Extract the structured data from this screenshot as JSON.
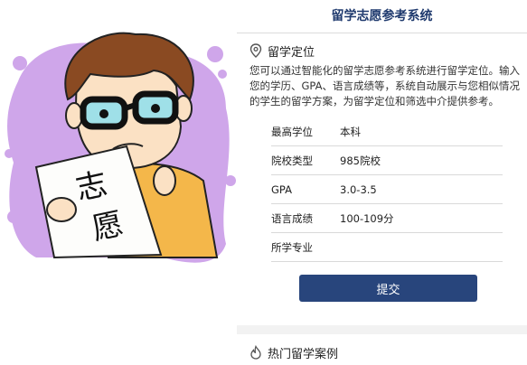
{
  "illustration": {
    "sign_text_1": "志",
    "sign_text_2": "愿"
  },
  "header": {
    "title": "留学志愿参考系统"
  },
  "section_positioning": {
    "title": "留学定位",
    "description": "您可以通过智能化的留学志愿参考系统进行留学定位。输入您的学历、GPA、语言成绩等，系统自动展示与您相似情况的学生的留学方案，为留学定位和筛选中介提供参考。"
  },
  "form": {
    "rows": [
      {
        "label": "最高学位",
        "value": "本科"
      },
      {
        "label": "院校类型",
        "value": "985院校"
      },
      {
        "label": "GPA",
        "value": "3.0-3.5"
      },
      {
        "label": "语言成绩",
        "value": "100-109分"
      },
      {
        "label": "所学专业",
        "value": ""
      }
    ],
    "submit_label": "提交"
  },
  "section_cases": {
    "title": "热门留学案例"
  },
  "colors": {
    "brand": "#28457c",
    "title": "#1f3a6e",
    "blob": "#c9a3e6"
  }
}
